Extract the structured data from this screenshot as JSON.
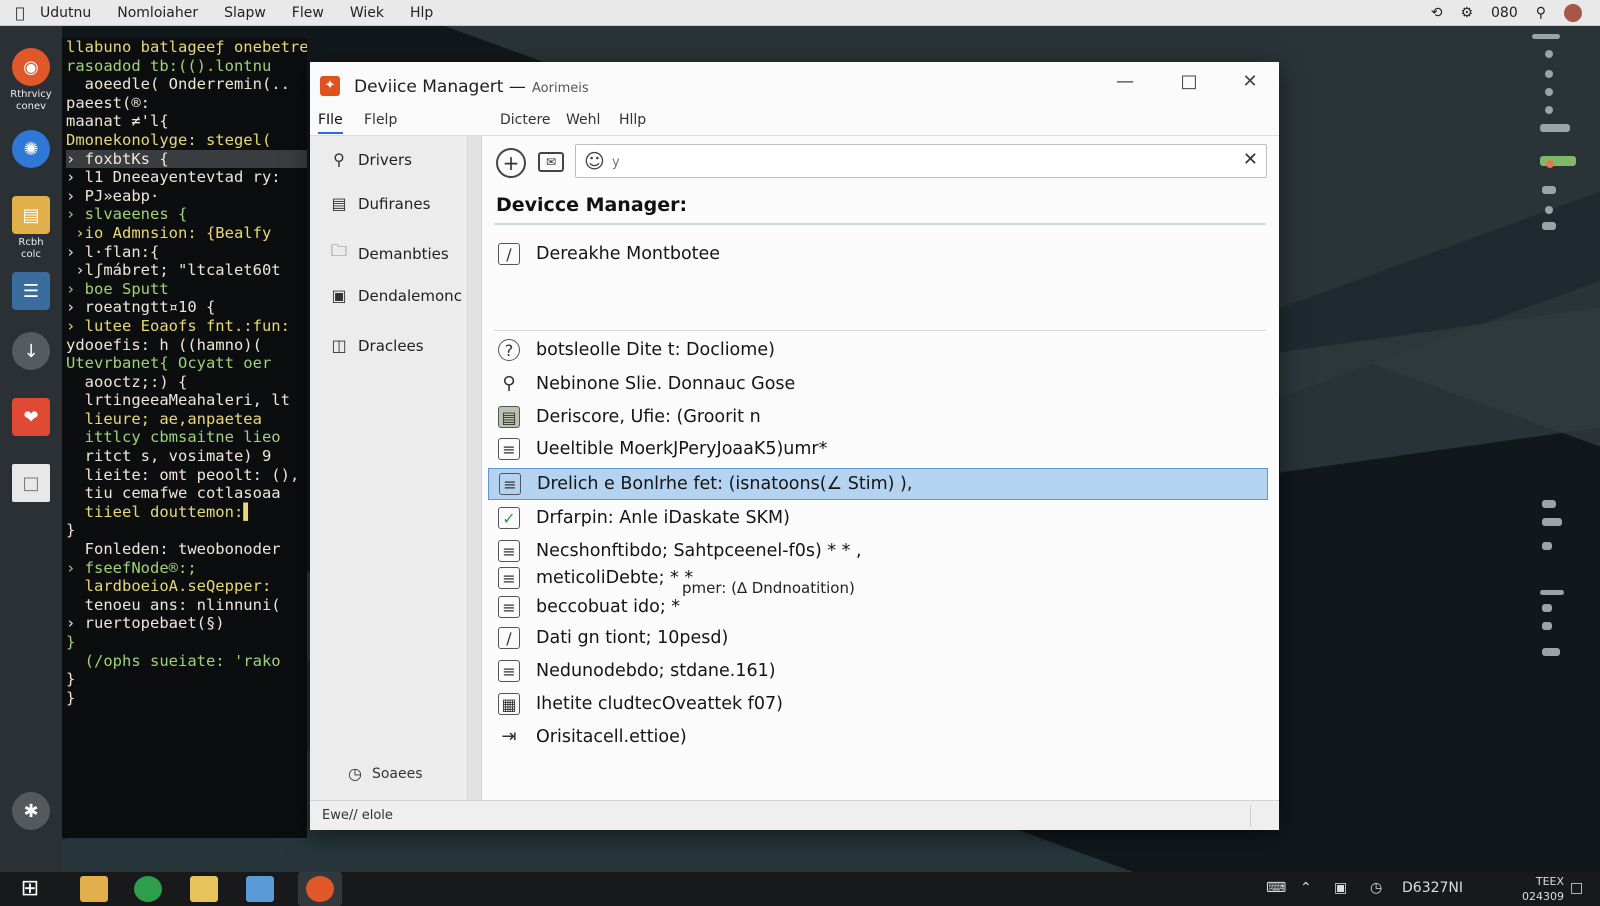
{
  "menubar": {
    "items": [
      "Udutnu",
      "Nomloiaher",
      "Slapw",
      "Flew",
      "Wiek",
      "Hlp"
    ],
    "right_text": "080",
    "icons": [
      "sync-icon",
      "gear-icon",
      "search-icon",
      "avatar"
    ]
  },
  "dock": {
    "items": [
      {
        "label": "Rthrvicy conev",
        "icon": "browser-icon",
        "color": "#e0582a"
      },
      {
        "label": "",
        "icon": "firefox-icon",
        "color": "#2f78d6"
      },
      {
        "label": "Rcbh colc",
        "icon": "files-icon",
        "color": "#e2b04a"
      },
      {
        "label": "",
        "icon": "editor-icon",
        "color": "#3a6c9e"
      },
      {
        "label": "",
        "icon": "download-icon",
        "color": "#555b60"
      },
      {
        "label": "",
        "icon": "app-icon",
        "color": "#e04a35"
      },
      {
        "label": "",
        "icon": "document-icon",
        "color": "#e8e8e8"
      },
      {
        "label": "",
        "icon": "settings-icon",
        "color": "#55595c"
      }
    ]
  },
  "terminal": {
    "lines": [
      "llabuno batlageeƒ onebetreenf |{",
      "rasoadod tb:(().lontnu",
      "  aoeedle( Onderremin(..",
      "paeest(®:",
      "maanat ≠'l{",
      "Dmonekonolyge: stegel(",
      "› foxbtKs {",
      "› l1 Dneeayentevtad ry:",
      "› PJ»eabp·",
      "› slvaeenes {",
      " ›io Admnsion: {Bealfy",
      "› l·flan:{",
      " ›lʃmábret; \"ltcalet60t",
      "› boe Sputt",
      "› roeatngtt¤10 {",
      "› lutee Eoaofs fnt.:fun:",
      "ydooefis: h ((hamno)(",
      "Utevrbanet{ Ocyatt oer",
      "  aooctz;:) {",
      "  lrtingeeaMeahaleri, lt",
      "  lieure; ae,anpaetea",
      "  ittlcy cbmsaitne lieo",
      "  ritct s, vosimate) 9",
      "  lieite: omt peoolt: (),",
      "  tiu cemafwe cotlasoaa",
      "  tiieel douttemon:▌",
      "}",
      "",
      "  Fonleden: tweobonoder",
      "› fseefNode®:;",
      "  lardboeioA.seQepper:",
      "  tenoeu ans: nlinnuni(",
      "› ruertopebaet(§)",
      "}",
      "",
      "",
      "",
      "  (/ophs sueiate: 'rako",
      "}",
      "}"
    ]
  },
  "window": {
    "title": "Deviice Managert —",
    "subtitle": "Aorimeis",
    "controls": [
      "minimize-button",
      "maximize-button",
      "close-button"
    ],
    "menus": {
      "left": [
        "FIle",
        "Flelp"
      ],
      "right": [
        "Dictere",
        "Wehl",
        "Hllp"
      ]
    },
    "sidebar": {
      "items": [
        {
          "label": "Drivers",
          "icon": "search-icon"
        },
        {
          "label": "Dufiranes",
          "icon": "document-icon"
        },
        {
          "label": "Demanbties",
          "icon": "folder-icon"
        },
        {
          "label": "Dendalemonc",
          "icon": "panel-icon"
        },
        {
          "label": "Draclees",
          "icon": "puzzle-icon"
        }
      ],
      "footer": {
        "label": "Soaees",
        "icon": "clock-icon"
      }
    },
    "search": {
      "placeholder": "y",
      "value": ""
    },
    "heading": "Devicce Manager:",
    "rows": [
      {
        "label": "Dereakhe Montbotee",
        "icon": "edit-icon"
      },
      {
        "label": "botsleolle Dite t: Docliome)",
        "icon": "clock-icon"
      },
      {
        "label": "Nebinone Slie. Donnauc Gose",
        "icon": "search-icon"
      },
      {
        "label": "Deriscore, Ufie: (Groorit n",
        "icon": "drive-icon"
      },
      {
        "label": "Ueeltible MoerkJPeryJoaaK5)umr*",
        "icon": "printer-icon"
      },
      {
        "label": "Drelich e Bonlrhe fet: (isnatoons(∠ Stim) ),",
        "icon": "list-icon",
        "selected": true
      },
      {
        "label": "Drfarpin: Anle iDaskate SKM)",
        "icon": "check-icon"
      },
      {
        "label": "Necshonftibdo; Sahtpceenel-f0s) * * ,",
        "icon": "list-icon"
      },
      {
        "label": "meticoliDebte; * *",
        "icon": "list-icon"
      },
      {
        "label": "beccobuat ido; *",
        "icon": "edit-list-icon"
      },
      {
        "label": "Dati gn tiont; 10pesd)",
        "icon": "edit-icon"
      },
      {
        "label": "Nedunodebdo; stdane.161)",
        "icon": "list-icon"
      },
      {
        "label": "Ihetite cludtecOveattek f07)",
        "icon": "grid-icon"
      },
      {
        "label": "Orisitacell.ettioe)",
        "icon": "arrow-right-icon"
      }
    ],
    "popover": "pmer: (∆ Dndnoatition)",
    "status": "Ewe// elole"
  },
  "taskbar": {
    "tray_icons": [
      "keyboard-icon",
      "chevron-up-icon",
      "network-icon",
      "clock-icon"
    ],
    "tray_text": "D6327NI",
    "clock_line1": "TEEX",
    "clock_line2": "024309"
  }
}
